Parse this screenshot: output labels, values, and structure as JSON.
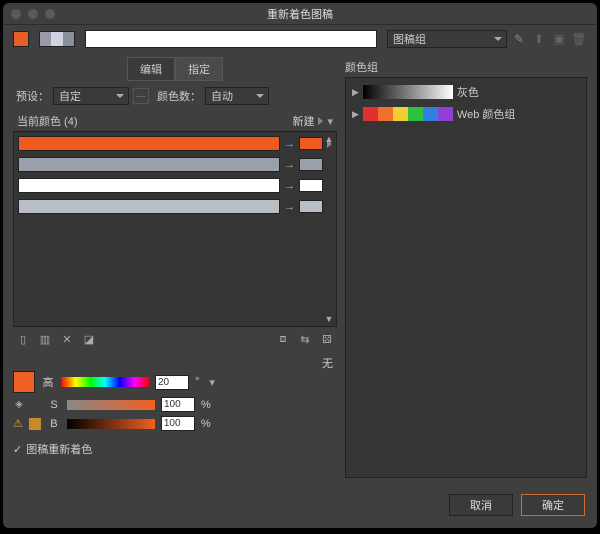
{
  "window": {
    "title": "重新着色图稿"
  },
  "toolbar": {
    "preset_select": "图稿组"
  },
  "tabs": {
    "edit": "编辑",
    "assign": "指定"
  },
  "preset": {
    "label": "预设：",
    "value": "自定",
    "colors_label": "颜色数：",
    "colors_value": "自动"
  },
  "current": {
    "label": "当前颜色 (4)",
    "new_label": "新建"
  },
  "rows": [
    {
      "bar": "#ef5a21",
      "chip": "#ef5a21"
    },
    {
      "bar": "#9aa0a9",
      "chip": "#9aa0a9"
    },
    {
      "bar": "#ffffff",
      "chip": "#ffffff"
    },
    {
      "bar": "#b9bdc4",
      "chip": "#b9bdc4"
    }
  ],
  "hsb": {
    "h_label": "高",
    "h_value": "20",
    "h_unit": "°",
    "s_label": "S",
    "s_value": "100",
    "s_unit": "%",
    "b_label": "B",
    "b_value": "100",
    "b_unit": "%"
  },
  "none_label": "无",
  "recolor_checkbox": "图稿重新着色",
  "right_title": "颜色组",
  "groups": [
    {
      "name": "灰色"
    },
    {
      "name": "Web 颜色组"
    }
  ],
  "footer": {
    "cancel": "取消",
    "ok": "确定"
  }
}
